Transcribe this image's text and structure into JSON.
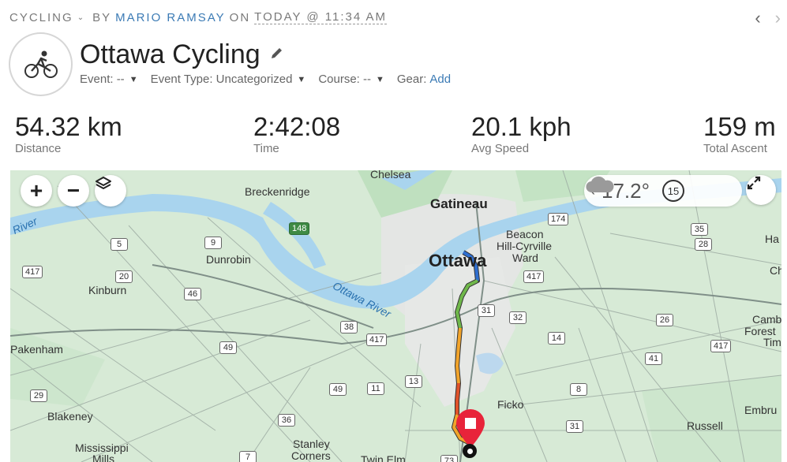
{
  "header": {
    "category": "CYCLING",
    "by": "BY",
    "author": "MARIO RAMSAY",
    "on": "ON",
    "time": "TODAY @ 11:34 AM",
    "title": "Ottawa Cycling",
    "meta": {
      "event_label": "Event: --",
      "event_type_label": "Event Type: Uncategorized",
      "course_label": "Course: --",
      "gear_label": "Gear:",
      "gear_link": "Add"
    }
  },
  "stats": [
    {
      "value": "54.32 km",
      "label": "Distance"
    },
    {
      "value": "2:42:08",
      "label": "Time"
    },
    {
      "value": "20.1 kph",
      "label": "Avg Speed"
    },
    {
      "value": "159 m",
      "label": "Total Ascent"
    }
  ],
  "map": {
    "weather": {
      "temperature": "17.2°",
      "wind": "15"
    },
    "places": {
      "chelsea": "Chelsea",
      "gatineau": "Gatineau",
      "breckenridge": "Breckenridge",
      "beacon1": "Beacon",
      "beacon2": "Hill-Cyrville",
      "beacon3": "Ward",
      "ottawa": "Ottawa",
      "dunrobin": "Dunrobin",
      "kinburn": "Kinburn",
      "pakenham": "Pakenham",
      "blakeney": "Blakeney",
      "mississippi1": "Mississippi",
      "mississippi2": "Mills",
      "stanley1": "Stanley",
      "stanley2": "Corners",
      "twinelm": "Twin Elm",
      "ficko": "Ficko",
      "russell": "Russell",
      "embrun": "Embru",
      "cambridge1": "Camb",
      "cambridge2": "Forest",
      "cambridge3": "Tim",
      "har": "Ha",
      "ch": "Ch",
      "river_left": "River",
      "ottawa_river": "Ottawa River"
    },
    "shields": [
      "174",
      "148",
      "5",
      "9",
      "35",
      "28",
      "417",
      "20",
      "46",
      "417",
      "31",
      "32",
      "38",
      "417",
      "26",
      "14",
      "417",
      "49",
      "41",
      "29",
      "49",
      "11",
      "13",
      "8",
      "36",
      "31",
      "7",
      "73"
    ]
  },
  "colors": {
    "link": "#3c7bb5",
    "water": "#a9d4ee",
    "land": "#d8ecd8",
    "route_start": "#2f6fd0",
    "pin": "#e8243a"
  }
}
